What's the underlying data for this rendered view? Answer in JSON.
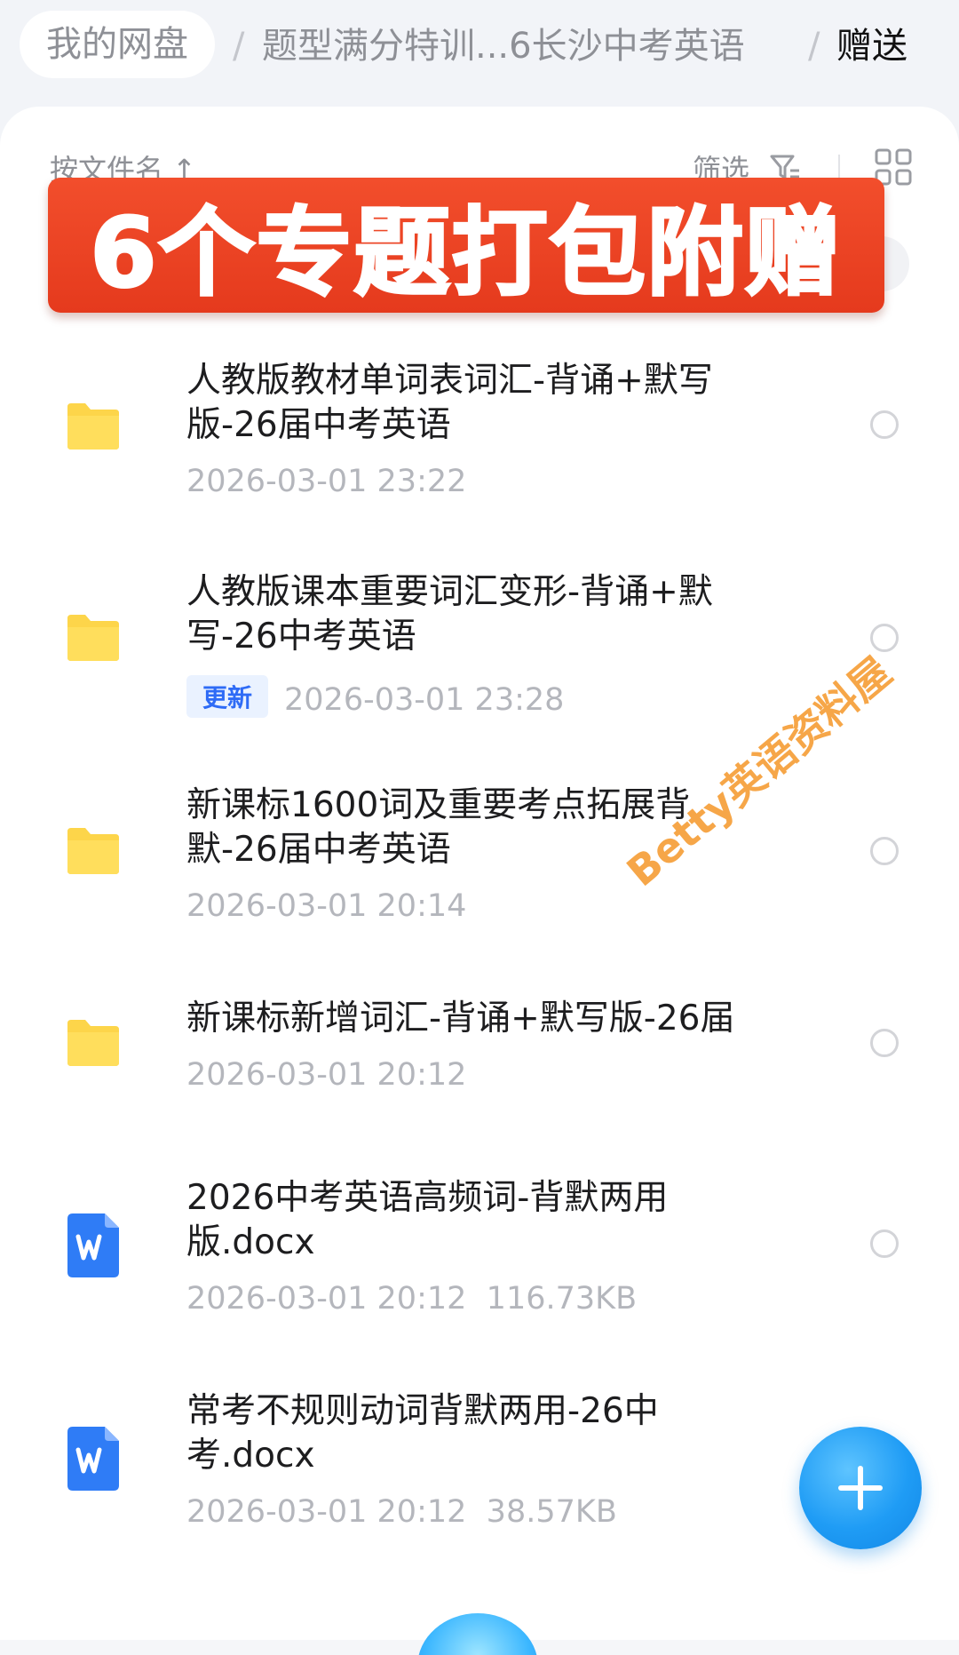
{
  "breadcrumb": {
    "home": "我的网盘",
    "separator": "/",
    "middle": "题型满分特训...6长沙中考英语",
    "current": "赠送"
  },
  "toolbar": {
    "sort_label": "按文件名 ↑",
    "filter_label": "筛选",
    "filter_icon": "filter-icon",
    "grid_icon": "grid-view-icon"
  },
  "banner": {
    "text": "6个专题打包附赠",
    "color": "#e8411f"
  },
  "files": [
    {
      "type": "folder",
      "icon": "folder-icon",
      "title": "人教版教材单词表词汇-背诵+默写版-26届中考英语",
      "date": "2026-03-01 23:22",
      "badge": "",
      "size": ""
    },
    {
      "type": "folder",
      "icon": "folder-icon",
      "title": "人教版课本重要词汇变形-背诵+默写-26中考英语",
      "date": "2026-03-01 23:28",
      "badge": "更新",
      "size": ""
    },
    {
      "type": "folder",
      "icon": "folder-icon",
      "title": "新课标1600词及重要考点拓展背默-26届中考英语",
      "date": "2026-03-01 20:14",
      "badge": "",
      "size": ""
    },
    {
      "type": "folder",
      "icon": "folder-icon",
      "title": "新课标新增词汇-背诵+默写版-26届",
      "date": "2026-03-01 20:12",
      "badge": "",
      "size": ""
    },
    {
      "type": "docx",
      "icon": "word-doc-icon",
      "title": "2026中考英语高频词-背默两用版.docx",
      "date": "2026-03-01 20:12",
      "badge": "",
      "size": "116.73KB"
    },
    {
      "type": "docx",
      "icon": "word-doc-icon",
      "title": "常考不规则动词背默两用-26中考.docx",
      "date": "2026-03-01 20:12",
      "badge": "",
      "size": "38.57KB"
    }
  ],
  "watermark": "Betty英语资料屋",
  "fab_icon": "plus-icon",
  "colors": {
    "folder": "#fdd54a",
    "word": "#2f7cf6",
    "accent": "#1f9cf5",
    "badge_text": "#2e6bf6"
  }
}
